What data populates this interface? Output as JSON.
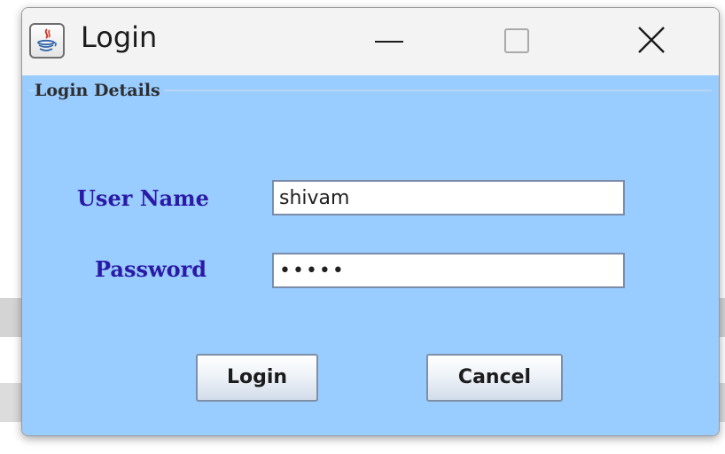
{
  "window": {
    "title": "Login",
    "app_icon": "java-cup-icon",
    "controls": [
      "minimize-icon",
      "maximize-icon",
      "close-icon"
    ]
  },
  "panel": {
    "group_title": "Login Details",
    "background_color": "#99ccff",
    "label_color": "#2a1aa6"
  },
  "form": {
    "username_label": "User Name",
    "username_value": "shivam",
    "password_label": "Password",
    "password_value": "•••••"
  },
  "buttons": {
    "login_label": "Login",
    "cancel_label": "Cancel"
  }
}
